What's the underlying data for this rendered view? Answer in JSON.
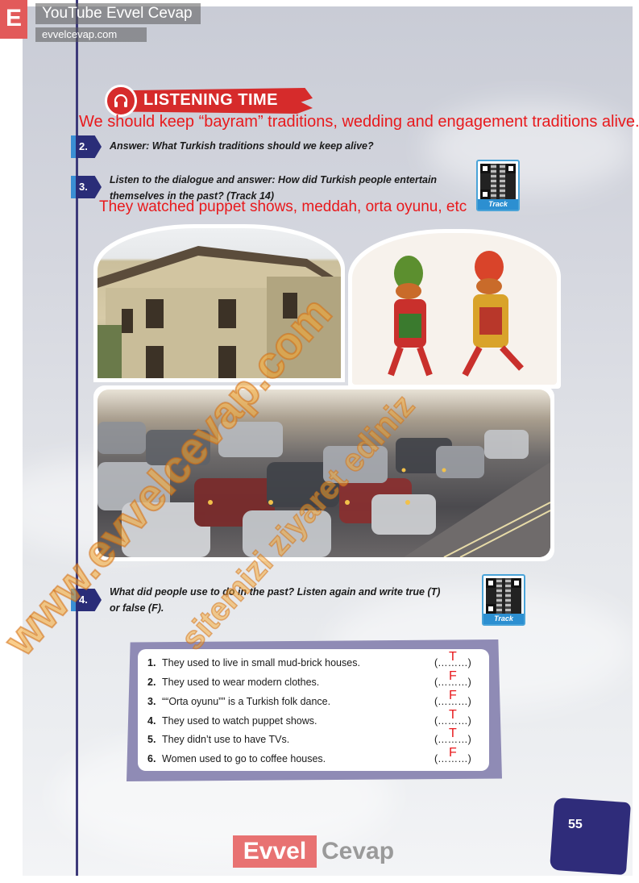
{
  "watermark": {
    "logo_letter": "E",
    "title": "YouTube Evvel Cevap",
    "url": "evvelcevap.com",
    "diagonal_main": "www.evvelcevap.com",
    "diagonal_secondary": "sitemizi ziyaret ediniz"
  },
  "section": {
    "heading": "LISTENING TIME",
    "icon": "headphones-icon"
  },
  "answers": {
    "q2": "We should keep “bayram” traditions, wedding and engagement traditions alive.",
    "q3": "They watched puppet shows, meddah, orta oyunu, etc"
  },
  "questions": [
    {
      "number": "2.",
      "text": "Answer: What Turkish traditions should we keep alive?"
    },
    {
      "number": "3.",
      "text_line1": "Listen to the dialogue and answer: How did Turkish people entertain",
      "text_line2": "themselves in the past? (Track 14)"
    },
    {
      "number": "4.",
      "text_line1": "What did people use to do in the past? Listen again and write true (T)",
      "text_line2": "or false (F)."
    }
  ],
  "qr_label": "Track",
  "statements": [
    {
      "n": "1.",
      "text": "They used to live in small mud-brick houses.",
      "blank": "(………)",
      "answer": "T"
    },
    {
      "n": "2.",
      "text": "They used to wear modern clothes.",
      "blank": "(………)",
      "answer": "F"
    },
    {
      "n": "3.",
      "text": "““Orta oyunu”” is a Turkish folk dance.",
      "blank": "(………)",
      "answer": "F"
    },
    {
      "n": "4.",
      "text": "They used to watch puppet shows.",
      "blank": "(………)",
      "answer": "T"
    },
    {
      "n": "5.",
      "text": "They didn’t use to have TVs.",
      "blank": "(………)",
      "answer": "T"
    },
    {
      "n": "6.",
      "text": "Women used to go to coffee houses.",
      "blank": "(………)",
      "answer": "F"
    }
  ],
  "page_number": "55",
  "footer_logo": {
    "part1": "Evvel",
    "part2": "Cevap"
  },
  "colors": {
    "accent_red": "#d62b2b",
    "answer_red": "#e8191c",
    "navy": "#2a2d78",
    "watermark_orange": "#f6a52d"
  }
}
